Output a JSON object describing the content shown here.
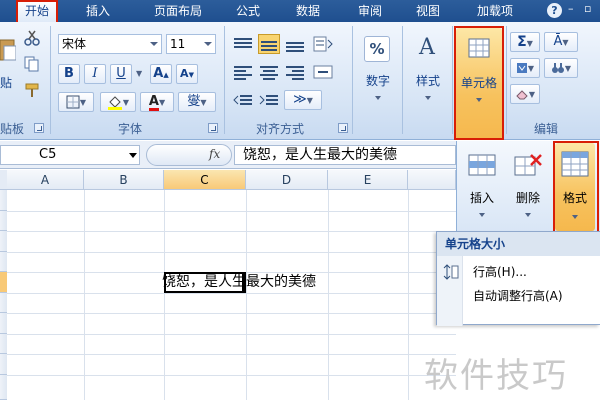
{
  "tabs": [
    "开始",
    "插入",
    "页面布局",
    "公式",
    "数据",
    "审阅",
    "视图",
    "加载项"
  ],
  "help_icon_label": "?",
  "clipboard": {
    "paste_label": "贴",
    "group_label": "贴板"
  },
  "font": {
    "name": "宋体",
    "size": "11",
    "bold": "B",
    "italic": "I",
    "underline": "U",
    "font_color_glyph": "A",
    "phonetic_glyph": "燮",
    "group_label": "字体"
  },
  "alignment": {
    "group_label": "对齐方式"
  },
  "number": {
    "label": "数字",
    "glyph": "%"
  },
  "styles": {
    "label": "样式",
    "glyph": "A"
  },
  "cells": {
    "label": "单元格"
  },
  "editing": {
    "label": "编辑",
    "sum_glyph": "Σ",
    "sort_glyph": "Ā"
  },
  "formula_bar": {
    "name_box": "C5",
    "fx": "fx",
    "content": "饶恕，是人生最大的美德"
  },
  "grid": {
    "columns": [
      "A",
      "B",
      "C",
      "D",
      "E"
    ],
    "selected_column": "C",
    "cell_text": "饶恕，是人生最大的美德"
  },
  "cells_panel": {
    "insert": "插入",
    "delete": "删除",
    "format": "格式"
  },
  "format_menu": {
    "header": "单元格大小",
    "items": [
      "行高(H)...",
      "自动调整行高(A)"
    ]
  },
  "watermark": "软件技巧",
  "colors": {
    "accent_red": "#d81e06",
    "tab_blue": "#1f4f8f",
    "selection": "#f8c977"
  }
}
